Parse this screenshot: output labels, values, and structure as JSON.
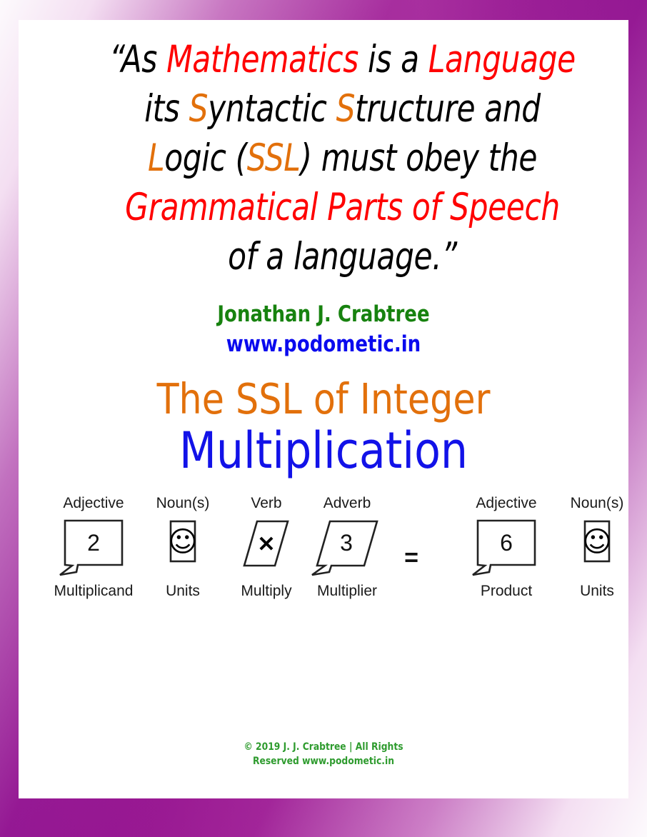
{
  "theme": {
    "frame_gradient_dark": "#8E0F8E",
    "frame_gradient_light": "#FFFFFF",
    "card_background": "#FFFFFF",
    "accent_red": "#FF0000",
    "accent_orange": "#E2700B",
    "accent_blue": "#1212E8",
    "accent_green": "#17820F",
    "link_blue": "#0A0AEE",
    "footer_green": "#2E9B2E"
  },
  "quote": {
    "line1_a": "“As ",
    "line1_b": "Mathematics",
    "line1_c": " is a ",
    "line1_d": "Language",
    "line2_a": "its ",
    "line2_b": "S",
    "line2_c": "yntactic ",
    "line2_d": "S",
    "line2_e": "tructure and",
    "line3_a": "L",
    "line3_b": "ogic (",
    "line3_c": "SSL",
    "line3_d": ") must obey the",
    "line4": "Grammatical Parts of Speech",
    "line5": "of a language.”"
  },
  "attribution": {
    "author": "Jonathan J. Crabtree",
    "website": "www.podometic.in"
  },
  "title": {
    "line1": "The SSL of Integer",
    "line2": "Multiplication"
  },
  "equation": {
    "operator_equals": "=",
    "terms": [
      {
        "id": "multiplicand",
        "part_of_speech": "Adjective",
        "value": "2",
        "role": "Multiplicand",
        "shape": "speech-bubble-rect",
        "icon": ""
      },
      {
        "id": "multiplicand-units",
        "part_of_speech": "Noun(s)",
        "value": "",
        "role": "Units",
        "shape": "rect",
        "icon": "smiley-face-icon"
      },
      {
        "id": "multiply-operator",
        "part_of_speech": "Verb",
        "value": "✕",
        "role": "Multiply",
        "shape": "parallelogram",
        "icon": "multiply-icon"
      },
      {
        "id": "multiplier",
        "part_of_speech": "Adverb",
        "value": "3",
        "role": "Multiplier",
        "shape": "speech-bubble-parallelogram",
        "icon": ""
      },
      {
        "id": "product",
        "part_of_speech": "Adjective",
        "value": "6",
        "role": "Product",
        "shape": "speech-bubble-rect",
        "icon": ""
      },
      {
        "id": "product-units",
        "part_of_speech": "Noun(s)",
        "value": "",
        "role": "Units",
        "shape": "rect",
        "icon": "smiley-face-icon"
      }
    ]
  },
  "footer": {
    "line1": "© 2019 J. J. Crabtree | All Rights",
    "line2": "Reserved  www.podometic.in"
  }
}
